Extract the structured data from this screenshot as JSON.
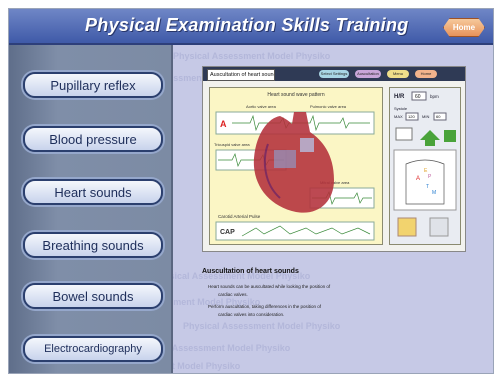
{
  "header": {
    "title": "Physical Examination Skills Training",
    "home_label": "Home"
  },
  "sidebar": {
    "items": [
      {
        "label": "Pupillary reflex"
      },
      {
        "label": "Blood pressure"
      },
      {
        "label": "Heart sounds"
      },
      {
        "label": "Breathing sounds"
      },
      {
        "label": "Bowel sounds"
      },
      {
        "label": "Electrocardiography"
      }
    ]
  },
  "watermark": {
    "text": "Physical Assessment Model Physiko"
  },
  "screen": {
    "title": "Auscultation of heart sounds",
    "buttons": [
      "Select Settings",
      "Auscultation",
      "Menu",
      "Home"
    ],
    "panel_title": "Heart sound wave pattern",
    "wave_labels": {
      "aortic": "Aortic valve area",
      "pulmonic": "Pulmonic valve area",
      "tricuspid": "Tricuspid valve area",
      "mitral": "Mitral valve area",
      "carotid": "Carotid Arterial Pulse"
    },
    "cap_label": "CAP",
    "hr_label": "H/R",
    "hr_value": "60",
    "hr_unit": "bpm",
    "bp_label": "Systole",
    "bp_max_label": "MAX",
    "bp_max": "120",
    "bp_min_label": "MIN",
    "bp_min": "60",
    "chest_labels": [
      "A",
      "P",
      "T",
      "M",
      "E"
    ]
  },
  "description": {
    "title": "Auscultation of heart sounds",
    "lines": [
      "Heart sounds can be auscultated while looking the position of",
      "cardiac valves.",
      "Perform auscultation, taking differences in the position of",
      "cardiac valves into consideration."
    ]
  }
}
